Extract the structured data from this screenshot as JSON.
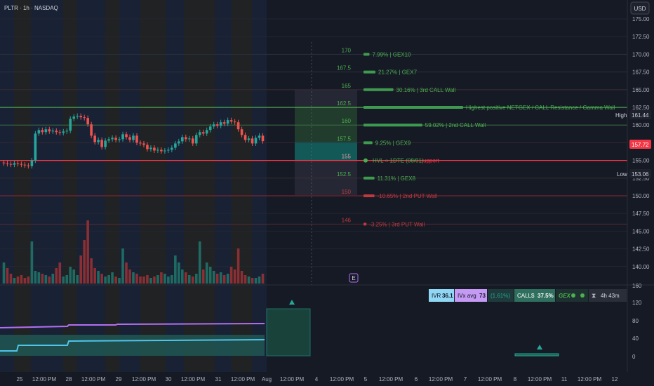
{
  "header": {
    "title": "PLTR · 1h · NASDAQ"
  },
  "currency_button": "USD",
  "price_axis": {
    "ticks": [
      "175.00",
      "172.50",
      "170.00",
      "167.50",
      "165.00",
      "162.50",
      "160.00",
      "157.50",
      "155.00",
      "152.50",
      "150.00",
      "147.50",
      "145.00",
      "142.50",
      "140.00"
    ],
    "high_label": "High",
    "high_value": "161.44",
    "low_label": "Low",
    "low_value": "153.06",
    "current_price": "157.72",
    "current_color": "#f23645"
  },
  "indicator_axis": {
    "ticks": [
      "160",
      "120",
      "80",
      "40",
      "0"
    ]
  },
  "time_axis": {
    "labels": [
      "25",
      "12:00 PM",
      "28",
      "12:00 PM",
      "29",
      "12:00 PM",
      "30",
      "12:00 PM",
      "31",
      "12:00 PM",
      "Aug",
      "12:00 PM",
      "4",
      "12:00 PM",
      "5",
      "12:00 PM",
      "6",
      "12:00 PM",
      "7",
      "12:00 PM",
      "8",
      "12:00 PM",
      "11",
      "12:00 PM",
      "12"
    ]
  },
  "levels": [
    {
      "strike": "170",
      "label": "7.99% | GEX10",
      "kind": "call",
      "bar_frac": 0.06
    },
    {
      "strike": "167.5",
      "label": "21.27% | GEX7",
      "kind": "call",
      "bar_frac": 0.12
    },
    {
      "strike": "165",
      "label": "30.16% | 3rd CALL Wall",
      "kind": "call",
      "bar_frac": 0.3
    },
    {
      "strike": "162.5",
      "label": "Highest positive NETGEX / CALL Resistance / Gamma Wall",
      "kind": "call",
      "bar_frac": 1.0
    },
    {
      "strike": "160",
      "label": "59.02% | 2nd CALL Wall",
      "kind": "call",
      "bar_frac": 0.59
    },
    {
      "strike": "157.5",
      "label": "9.25% | GEX9",
      "kind": "call",
      "bar_frac": 0.09
    },
    {
      "strike": "155",
      "label": "HVL ○ 1DTE (08/01)",
      "kind": "hvl",
      "bar_frac": 0
    },
    {
      "strike": "152.5",
      "label": "11.31% | GEX8",
      "kind": "call",
      "bar_frac": 0.11
    },
    {
      "strike": "150",
      "label": "-10.65% | 2nd PUT Wall",
      "kind": "put",
      "bar_frac": 0.11
    },
    {
      "strike": "146",
      "label": "-3.25% | 3rd PUT Wall",
      "kind": "put",
      "bar_frac": 0.03
    }
  ],
  "hvl_suffix": "upport",
  "earnings_marker": "E",
  "stats": {
    "ivr_label": "IVR",
    "ivr_value": "36.1",
    "ivx_label": "IVx avg",
    "ivx_value": "73",
    "change": "(1.61%)",
    "calls_label": "CALL$",
    "calls_value": "37.5%",
    "gex_label": "GEX",
    "timer": "4h 43m"
  },
  "colors": {
    "up": "#26a69a",
    "down": "#ef5350",
    "accent_purple": "#b36ef2",
    "accent_cyan": "#50c4e8"
  },
  "chart_data": {
    "type": "line",
    "title": "PLTR · 1h · NASDAQ",
    "xlabel": "",
    "ylabel": "USD",
    "ylim": [
      137.5,
      177.5
    ],
    "x": [
      "Jul 25",
      "Jul 28",
      "Jul 29",
      "Jul 30",
      "Jul 31",
      "Aug 1"
    ],
    "series": [
      {
        "values": [
          154.6,
          154.5,
          154.4,
          154.6,
          154.5,
          154.4,
          154.3,
          154.2,
          155.0,
          158.8,
          159.3,
          159.0,
          159.4,
          159.1,
          159.2,
          159.0,
          158.9,
          159.1,
          159.2,
          160.9,
          161.2,
          161.3,
          161.1,
          161.0,
          160.1,
          158.5,
          157.6,
          157.9,
          156.9,
          157.8,
          158.0,
          158.2,
          157.9,
          158.0,
          158.7,
          158.3,
          157.9,
          158.5,
          157.5,
          157.4,
          157.2,
          156.6,
          156.8,
          156.4,
          156.5,
          156.3,
          156.4,
          156.5,
          156.8,
          157.4,
          157.7,
          158.3,
          158.0,
          158.1,
          157.4,
          158.6,
          159.0,
          158.8,
          159.3,
          159.8,
          160.1,
          159.9,
          160.4,
          160.2,
          160.7,
          160.5,
          160.4,
          159.4,
          158.6,
          157.9,
          158.1,
          157.4,
          158.2,
          158.5,
          157.72
        ]
      }
    ],
    "volume_panel": {
      "note": "relative hourly volume bars (up = green, down = red)"
    },
    "annotations": [
      "High 161.44",
      "Low 153.06",
      "157.72"
    ]
  }
}
